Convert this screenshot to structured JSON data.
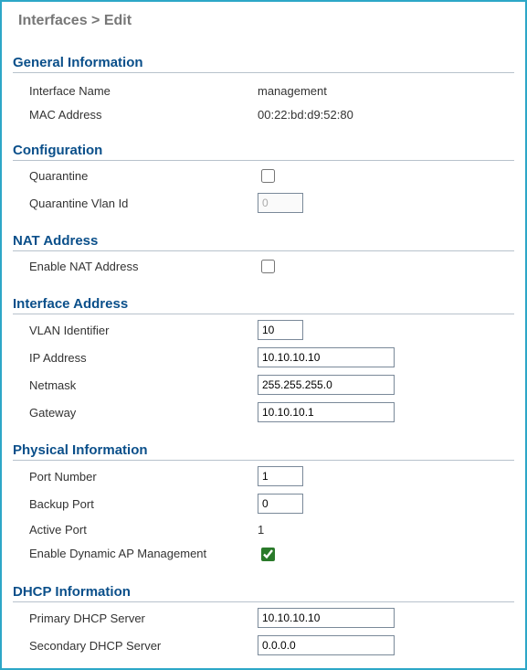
{
  "breadcrumb": "Interfaces > Edit",
  "sections": {
    "general": {
      "heading": "General Information",
      "interface_name_label": "Interface Name",
      "interface_name_value": "management",
      "mac_label": "MAC Address",
      "mac_value": "00:22:bd:d9:52:80"
    },
    "configuration": {
      "heading": "Configuration",
      "quarantine_label": "Quarantine",
      "quarantine_checked": false,
      "quarantine_vlan_label": "Quarantine Vlan Id",
      "quarantine_vlan_value": "0"
    },
    "nat": {
      "heading": "NAT Address",
      "enable_nat_label": "Enable NAT Address",
      "enable_nat_checked": false
    },
    "iface_addr": {
      "heading": "Interface Address",
      "vlan_label": "VLAN Identifier",
      "vlan_value": "10",
      "ip_label": "IP Address",
      "ip_value": "10.10.10.10",
      "netmask_label": "Netmask",
      "netmask_value": "255.255.255.0",
      "gateway_label": "Gateway",
      "gateway_value": "10.10.10.1"
    },
    "physical": {
      "heading": "Physical Information",
      "port_number_label": "Port Number",
      "port_number_value": "1",
      "backup_port_label": "Backup Port",
      "backup_port_value": "0",
      "active_port_label": "Active Port",
      "active_port_value": "1",
      "dyn_ap_label": "Enable Dynamic AP Management",
      "dyn_ap_checked": true
    },
    "dhcp": {
      "heading": "DHCP Information",
      "primary_label": "Primary DHCP Server",
      "primary_value": "10.10.10.10",
      "secondary_label": "Secondary DHCP Server",
      "secondary_value": "0.0.0.0"
    }
  },
  "colors": {
    "frame_border": "#2da7c7",
    "heading_text": "#0a4f8a",
    "rule": "#b8c2cc"
  }
}
